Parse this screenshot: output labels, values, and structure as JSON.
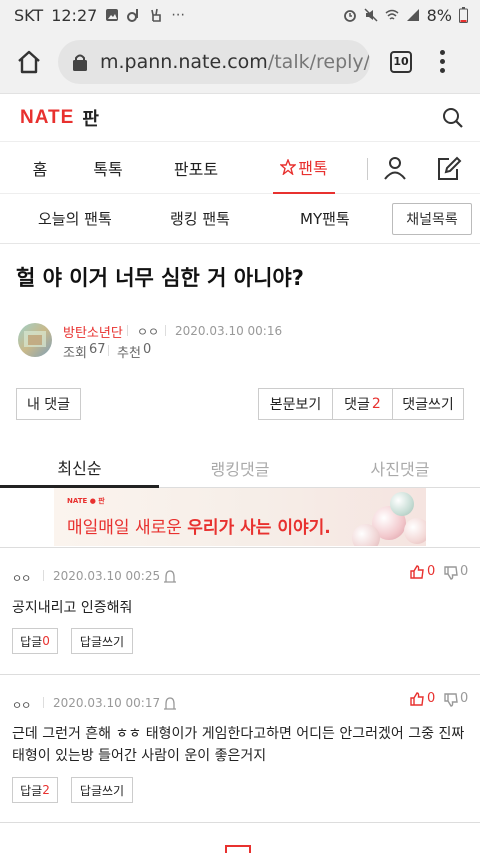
{
  "status": {
    "carrier": "SKT",
    "time": "12:27",
    "battery": "8%"
  },
  "browser": {
    "url_host": "m.pann.nate.com",
    "url_path": "/talk/reply/vi",
    "tabs_count": "10"
  },
  "header": {
    "logo": "NATE",
    "logo_sub": "판"
  },
  "mainnav": [
    "홈",
    "톡톡",
    "판포토",
    "팬톡"
  ],
  "subnav": {
    "items": [
      "오늘의 팬톡",
      "랭킹 팬톡",
      "MY팬톡"
    ],
    "channel_button": "채널목록"
  },
  "post": {
    "title": "헐 야 이거 너무 심한 거 아니야?",
    "author": "방탄소년단",
    "author_tag": "ㅇㅇ",
    "datetime": "2020.03.10 00:16",
    "views_label": "조회",
    "views": "67",
    "recommend_label": "추천",
    "recommend": "0"
  },
  "actions": {
    "my_comments": "내 댓글",
    "view_body": "본문보기",
    "comments_label": "댓글",
    "comments_count": "2",
    "write_comment": "댓글쓰기"
  },
  "comment_tabs": [
    "최신순",
    "랭킹댓글",
    "사진댓글"
  ],
  "banner": {
    "logo": "NATE ● 판",
    "text_pre": "매일매일 새로운 ",
    "text_bold": "우리가 사는 이야기."
  },
  "comments": [
    {
      "author": "ㅇㅇ",
      "datetime": "2020.03.10 00:25",
      "likes": "0",
      "dislikes": "0",
      "text": "공지내리고 인증해줘",
      "reply_label": "답글",
      "reply_count": "0",
      "write_reply": "답글쓰기"
    },
    {
      "author": "ㅇㅇ",
      "datetime": "2020.03.10 00:17",
      "likes": "0",
      "dislikes": "0",
      "text": "근데 그런거 흔해 ㅎㅎ 태형이가 게임한다고하면 어디든 안그러겠어 그중 진짜 태형이 있는방 들어간 사람이 운이 좋은거지",
      "reply_label": "답글",
      "reply_count": "2",
      "write_reply": "답글쓰기"
    }
  ]
}
